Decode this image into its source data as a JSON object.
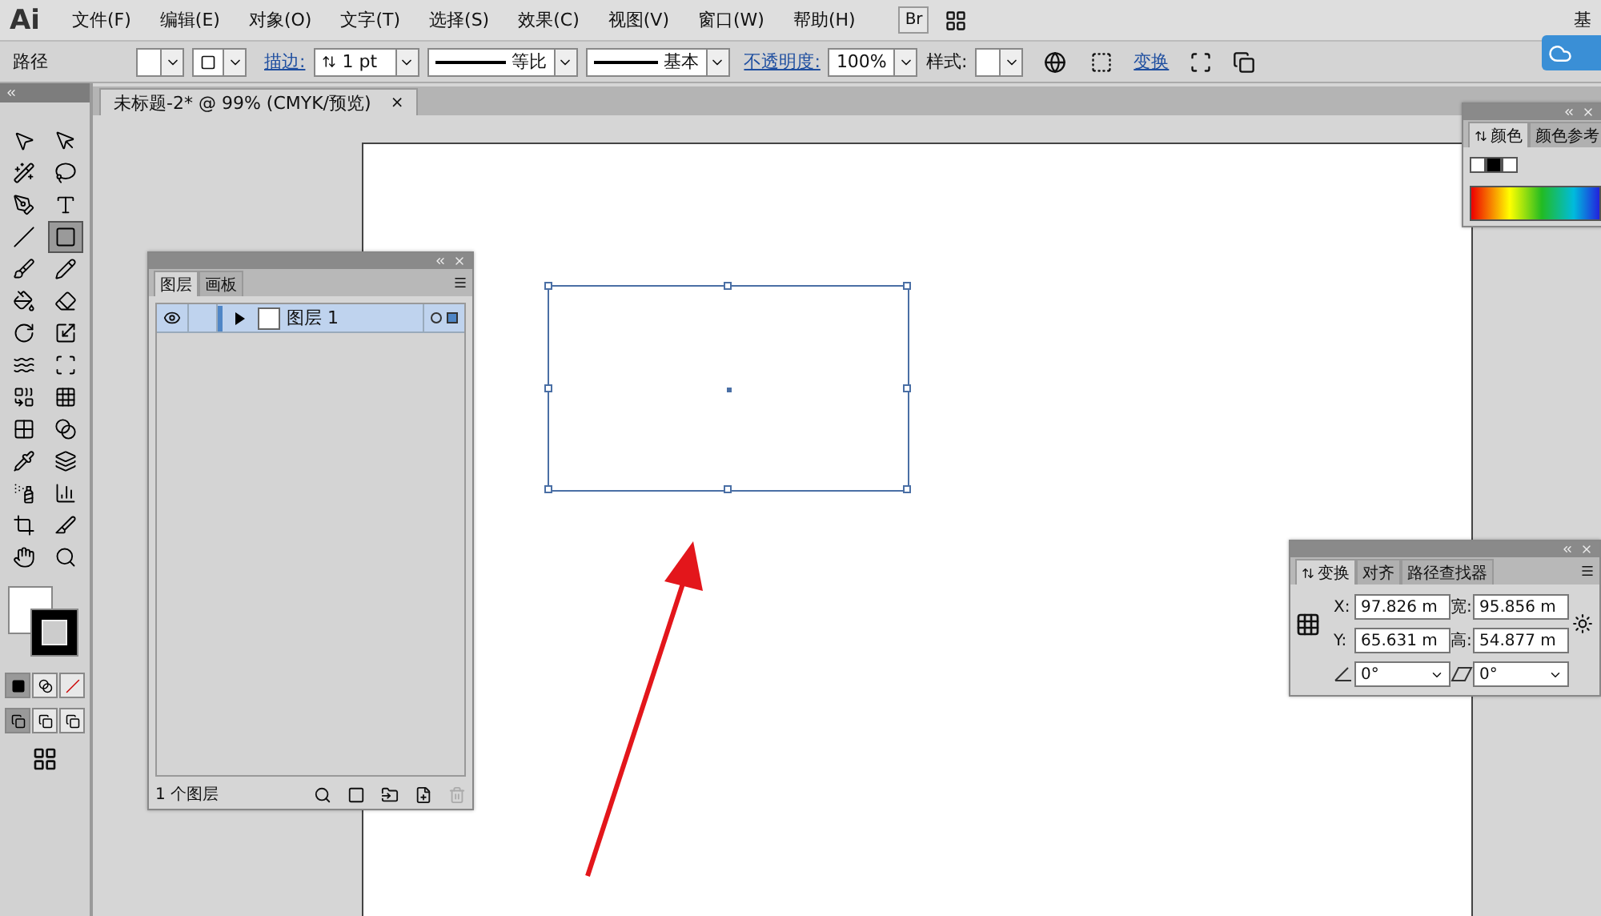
{
  "app": {
    "logo": "Ai"
  },
  "menu": [
    "文件(F)",
    "编辑(E)",
    "对象(O)",
    "文字(T)",
    "选择(S)",
    "效果(C)",
    "视图(V)",
    "窗口(W)",
    "帮助(H)"
  ],
  "menu_right": {
    "bridge": "Br",
    "workspace": "基"
  },
  "control_bar": {
    "selection": "路径",
    "stroke_link": "描边:",
    "stroke_weight": "1 pt",
    "profile": "等比",
    "brush": "基本",
    "opacity_link": "不透明度:",
    "opacity": "100%",
    "style_label": "样式:",
    "transform_link": "变换"
  },
  "document_tab": {
    "title": "未标题-2* @ 99% (CMYK/预览)",
    "close": "×"
  },
  "tools": [
    {
      "kind": "selection",
      "selected": false
    },
    {
      "kind": "direct-selection",
      "selected": false
    },
    {
      "kind": "magic-wand",
      "selected": false
    },
    {
      "kind": "lasso",
      "selected": false
    },
    {
      "kind": "pen",
      "selected": false
    },
    {
      "kind": "type",
      "selected": false
    },
    {
      "kind": "line",
      "selected": false
    },
    {
      "kind": "rectangle",
      "selected": true
    },
    {
      "kind": "brush",
      "selected": false
    },
    {
      "kind": "pencil",
      "selected": false
    },
    {
      "kind": "blob-brush",
      "selected": false
    },
    {
      "kind": "eraser",
      "selected": false
    },
    {
      "kind": "rotate",
      "selected": false
    },
    {
      "kind": "scale",
      "selected": false
    },
    {
      "kind": "warp",
      "selected": false
    },
    {
      "kind": "free-transform",
      "selected": false
    },
    {
      "kind": "shape-builder",
      "selected": false
    },
    {
      "kind": "perspective-grid",
      "selected": false
    },
    {
      "kind": "mesh",
      "selected": false
    },
    {
      "kind": "gradient",
      "selected": false
    },
    {
      "kind": "eyedropper",
      "selected": false
    },
    {
      "kind": "blend",
      "selected": false
    },
    {
      "kind": "symbol-sprayer",
      "selected": false
    },
    {
      "kind": "column-graph",
      "selected": false
    },
    {
      "kind": "artboard",
      "selected": false
    },
    {
      "kind": "slice",
      "selected": false
    },
    {
      "kind": "hand",
      "selected": false
    },
    {
      "kind": "zoom",
      "selected": false
    }
  ],
  "color_panel": {
    "tabs": [
      {
        "label": "颜色",
        "selected": true
      },
      {
        "label": "颜色参考",
        "selected": false
      }
    ]
  },
  "layers_panel": {
    "tabs": [
      {
        "label": "图层",
        "selected": true
      },
      {
        "label": "画板",
        "selected": false
      }
    ],
    "layers": [
      {
        "name": "图层 1",
        "visible": true,
        "selected": true,
        "expanded": false,
        "color": "#4f86c6"
      }
    ],
    "count": "1 个图层"
  },
  "transform_panel": {
    "tabs": [
      {
        "label": "变换",
        "selected": true
      },
      {
        "label": "对齐",
        "selected": false
      },
      {
        "label": "路径查找器",
        "selected": false
      }
    ],
    "fields": [
      {
        "label": "X:",
        "value": "97.826 m"
      },
      {
        "label": "宽:",
        "value": "95.856 m"
      },
      {
        "label": "Y:",
        "value": "65.631 m"
      },
      {
        "label": "高:",
        "value": "54.877 m"
      }
    ],
    "rotate": "0°",
    "shear": "0°"
  }
}
